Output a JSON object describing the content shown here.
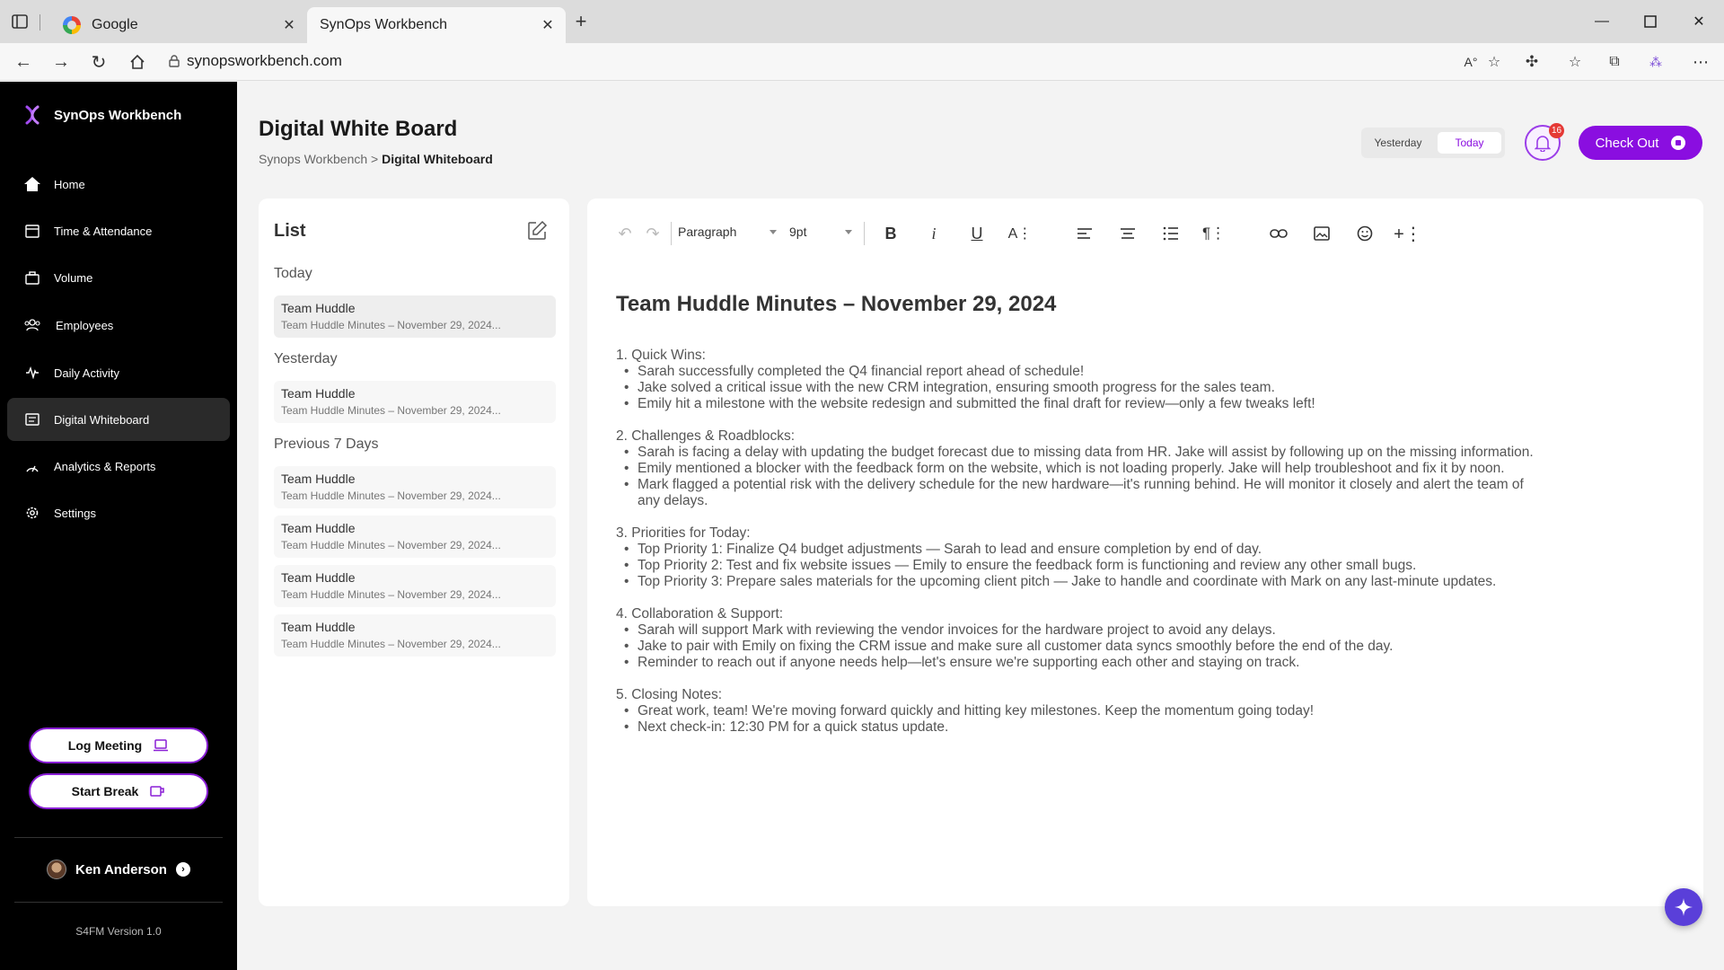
{
  "browser": {
    "tabs": [
      {
        "title": "Google"
      },
      {
        "title": "SynOps Workbench"
      }
    ],
    "url": "synopsworkbench.com"
  },
  "sidebar": {
    "brand": "SynOps Workbench",
    "items": [
      {
        "label": "Home",
        "icon": "home-icon"
      },
      {
        "label": "Time & Attendance",
        "icon": "calendar-icon"
      },
      {
        "label": "Volume",
        "icon": "briefcase-icon"
      },
      {
        "label": "Employees",
        "icon": "users-icon"
      },
      {
        "label": "Daily Activity",
        "icon": "activity-icon"
      },
      {
        "label": "Digital Whiteboard",
        "icon": "whiteboard-icon",
        "active": true
      },
      {
        "label": "Analytics & Reports",
        "icon": "analytics-icon"
      },
      {
        "label": "Settings",
        "icon": "gear-icon"
      }
    ],
    "log_meeting": "Log Meeting",
    "start_break": "Start Break",
    "user_name": "Ken Anderson",
    "version": "S4FM Version 1.0"
  },
  "header": {
    "title": "Digital White Board",
    "breadcrumb_root": "Synops Workbench",
    "breadcrumb_sep": " > ",
    "breadcrumb_current": "Digital Whiteboard",
    "toggle_yesterday": "Yesterday",
    "toggle_today": "Today",
    "notification_count": "16",
    "checkout_label": "Check Out",
    "accent_color": "#8a0ee0"
  },
  "list": {
    "title": "List",
    "groups": {
      "today": "Today",
      "yesterday": "Yesterday",
      "previous": "Previous 7 Days"
    },
    "items": [
      {
        "title": "Team Huddle",
        "subtitle": "Team Huddle Minutes – November 29, 2024..."
      },
      {
        "title": "Team Huddle",
        "subtitle": "Team Huddle Minutes – November 29, 2024..."
      },
      {
        "title": "Team Huddle",
        "subtitle": "Team Huddle Minutes – November 29, 2024..."
      },
      {
        "title": "Team Huddle",
        "subtitle": "Team Huddle Minutes – November 29, 2024..."
      },
      {
        "title": "Team Huddle",
        "subtitle": "Team Huddle Minutes – November 29, 2024..."
      },
      {
        "title": "Team Huddle",
        "subtitle": "Team Huddle Minutes – November 29, 2024..."
      }
    ]
  },
  "editor": {
    "block_style": "Paragraph",
    "font_size": "9pt",
    "doc_title": "Team Huddle Minutes – November 29, 2024",
    "sections": [
      {
        "heading": "1. Quick Wins:",
        "bullets": [
          "Sarah successfully completed the Q4 financial report ahead of schedule!",
          "Jake solved a critical issue with the new CRM integration, ensuring smooth progress for the sales team.",
          "Emily hit a milestone with the website redesign and submitted the final draft for review—only a few tweaks left!"
        ]
      },
      {
        "heading": "2. Challenges & Roadblocks:",
        "bullets": [
          "Sarah is facing a delay with updating the budget forecast due to missing data from HR. Jake will assist by following up on the missing information.",
          "Emily mentioned a blocker with the feedback form on the website, which is not loading properly. Jake will help troubleshoot and fix it by noon.",
          "Mark flagged a potential risk with the delivery schedule for the new hardware—it's running behind. He will monitor it closely and alert the team of any delays."
        ]
      },
      {
        "heading": "3. Priorities for Today:",
        "bullets": [
          "Top Priority 1: Finalize Q4 budget adjustments — Sarah to lead and ensure completion by end of day.",
          "Top Priority 2: Test and fix website issues — Emily to ensure the feedback form is functioning and review any other small bugs.",
          "Top Priority 3: Prepare sales materials for the upcoming client pitch — Jake to handle and coordinate with Mark on any last-minute updates."
        ]
      },
      {
        "heading": "4. Collaboration & Support:",
        "bullets": [
          "Sarah will support Mark with reviewing the vendor invoices for the hardware project to avoid any delays.",
          "Jake to pair with Emily on fixing the CRM issue and make sure all customer data syncs smoothly before the end of the day.",
          "Reminder to reach out if anyone needs help—let's ensure we're supporting each other and staying on track."
        ]
      },
      {
        "heading": "5. Closing Notes:",
        "bullets": [
          "Great work, team! We're moving forward quickly and hitting key milestones. Keep the momentum going today!",
          "Next check-in: 12:30 PM for a quick status update."
        ]
      }
    ]
  }
}
